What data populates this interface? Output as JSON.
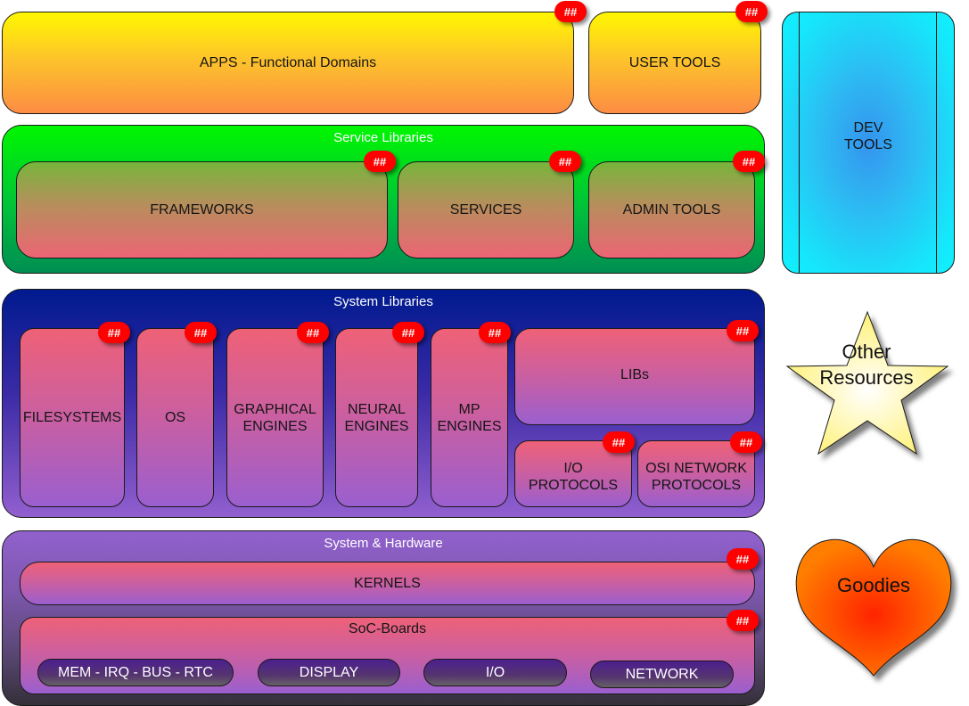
{
  "badge_text": "##",
  "top_row": {
    "apps": {
      "label": "APPS - Functional Domains"
    },
    "user_tools": {
      "label": "USER TOOLS"
    }
  },
  "dev_tools": {
    "label": "DEV\nTOOLS"
  },
  "service_libraries": {
    "title": "Service Libraries",
    "items": [
      {
        "label": "FRAMEWORKS"
      },
      {
        "label": "SERVICES"
      },
      {
        "label": "ADMIN TOOLS"
      }
    ]
  },
  "system_libraries": {
    "title": "System Libraries",
    "items": [
      {
        "label": "FILESYSTEMS"
      },
      {
        "label": "OS"
      },
      {
        "label": "GRAPHICAL\nENGINES"
      },
      {
        "label": "NEURAL\nENGINES"
      },
      {
        "label": "MP\nENGINES"
      },
      {
        "label": "LIBs"
      },
      {
        "label": "I/O\nPROTOCOLS"
      },
      {
        "label": "OSI NETWORK\nPROTOCOLS"
      }
    ]
  },
  "system_hardware": {
    "title": "System & Hardware",
    "kernels": {
      "label": "KERNELS"
    },
    "soc_boards": {
      "label": "SoC-Boards",
      "components": [
        {
          "label": "MEM - IRQ - BUS - RTC"
        },
        {
          "label": "DISPLAY"
        },
        {
          "label": "I/O"
        },
        {
          "label": "NETWORK"
        }
      ]
    }
  },
  "side_shapes": {
    "star": {
      "label_line1": "Other",
      "label_line2": "Resources"
    },
    "heart": {
      "label": "Goodies"
    }
  },
  "colors": {
    "badge": "#ff0000",
    "apps_top": "#fff700",
    "apps_bottom": "#fd8c44",
    "service_top": "#00f700",
    "service_bottom": "#008e52",
    "system_lib_top": "#001a8f",
    "system_lib_bottom": "#925fcf",
    "hardware_bottom": "#343039",
    "dev_tools_edge": "#0ff2ff",
    "dev_tools_center": "#3594ee",
    "star_fill": "#fff79a",
    "heart_center": "#ff2a00",
    "heart_edge": "#ff7a00"
  }
}
